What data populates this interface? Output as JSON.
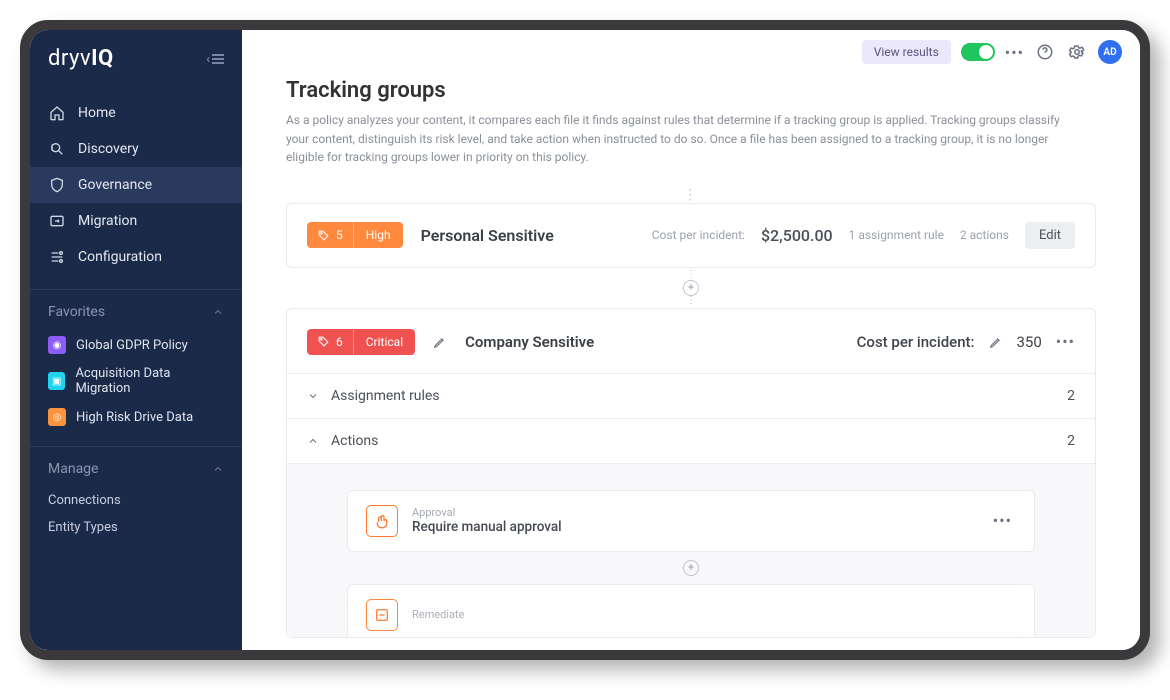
{
  "logo": {
    "part1": "dryv",
    "part2": "IQ"
  },
  "sidebar": {
    "nav": [
      {
        "label": "Home",
        "icon": "home"
      },
      {
        "label": "Discovery",
        "icon": "search"
      },
      {
        "label": "Governance",
        "icon": "shield"
      },
      {
        "label": "Migration",
        "icon": "migrate"
      },
      {
        "label": "Configuration",
        "icon": "config"
      }
    ],
    "favorites_label": "Favorites",
    "favorites": [
      {
        "label": "Global GDPR Policy",
        "color": "#8b5cf6"
      },
      {
        "label": "Acquisition Data Migration",
        "color": "#22d3ee"
      },
      {
        "label": "High Risk Drive Data",
        "color": "#fb923c"
      }
    ],
    "manage_label": "Manage",
    "manage": [
      {
        "label": "Connections"
      },
      {
        "label": "Entity Types"
      }
    ]
  },
  "topbar": {
    "view_results": "View results",
    "avatar": "AD"
  },
  "page": {
    "title": "Tracking groups",
    "description": "As a policy analyzes your content, it compares each file it finds against rules that determine if a tracking group is applied. Tracking groups classify your content, distinguish its risk level, and take action when instructed to do so. Once a file has been assigned to a tracking group, it is no longer eligible for tracking groups lower in priority on this policy."
  },
  "group1": {
    "count": "5",
    "risk": "High",
    "title": "Personal Sensitive",
    "cost_label": "Cost per incident:",
    "cost_value": "$2,500.00",
    "rule_text": "1 assignment rule",
    "actions_text": "2 actions",
    "edit": "Edit"
  },
  "group2": {
    "count": "6",
    "risk": "Critical",
    "title": "Company Sensitive",
    "cost_label": "Cost per incident:",
    "cost_value": "350",
    "assignment_label": "Assignment rules",
    "assignment_count": "2",
    "actions_label": "Actions",
    "actions_count": "2",
    "action1": {
      "category": "Approval",
      "title": "Require manual approval"
    },
    "action2": {
      "category": "Remediate",
      "title": ""
    }
  }
}
